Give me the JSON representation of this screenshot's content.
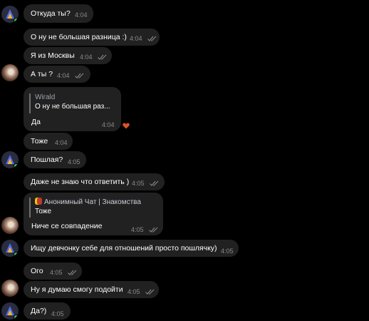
{
  "chat": {
    "messages": [
      {
        "text": "Откуда ты?",
        "time": "4:04"
      },
      {
        "text": "О ну не большая разница :)",
        "time": "4:04"
      },
      {
        "text": "Я из Москвы",
        "time": "4:04"
      },
      {
        "text": "А ты ?",
        "time": "4:04"
      },
      {
        "reply_name": "Wirald",
        "reply_text": "О ну не большая раз...",
        "text": "Да",
        "time": "4:04"
      },
      {
        "text": "Тоже",
        "time": "4:04"
      },
      {
        "text": "Пошлая?",
        "time": "4:05"
      },
      {
        "text": "Даже не знаю что ответить )",
        "time": "4:05"
      },
      {
        "reply_name": "Анонимный Чат | Знакомства",
        "reply_text": "Тоже",
        "text": "Ниче се совпадение",
        "time": "4:05"
      },
      {
        "text": "Ищу девчонку себе для отношений просто пошлячку)",
        "time": "4:05"
      },
      {
        "text": "Ого",
        "time": "4:05"
      },
      {
        "text": "Ну я думаю смогу подойти",
        "time": "4:05"
      },
      {
        "text": "Да?)",
        "time": "4:05"
      }
    ]
  },
  "colors": {
    "bubble": "#212121",
    "online": "#3fbf5a",
    "reaction_heart": "#d9542a",
    "bot_logo": [
      "#4b6df0",
      "#f0b23c"
    ]
  },
  "icons": {
    "bot_avatar": "anonymous-chat-logo-icon",
    "user_avatar": "user-photo-avatar",
    "read": "double-check-icon",
    "reaction": "heart-icon"
  }
}
